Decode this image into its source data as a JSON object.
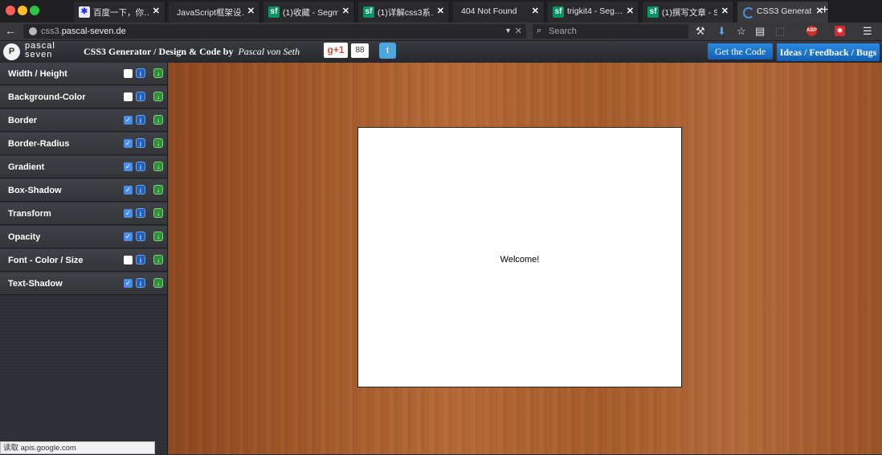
{
  "tabs": [
    {
      "title": "百度一下，你…",
      "favicon": "baidu-icon",
      "active": false
    },
    {
      "title": "JavaScript框架设…",
      "favicon": "",
      "active": false
    },
    {
      "title": "(1)收藏 - Segm…",
      "favicon": "sf-icon",
      "active": false
    },
    {
      "title": "(1)详解css3系…",
      "favicon": "sf-icon",
      "active": false
    },
    {
      "title": "404 Not Found",
      "favicon": "",
      "active": false
    },
    {
      "title": "trigkit4 - Seg…",
      "favicon": "sf-icon",
      "active": false
    },
    {
      "title": "(1)撰写文章 - S…",
      "favicon": "sf-icon",
      "active": false
    },
    {
      "title": "CSS3 Generat…",
      "favicon": "loading-icon",
      "active": true
    }
  ],
  "tab_close": "✕",
  "new_tab": "+",
  "favicon_sf_text": "sf",
  "favicon_baidu_text": "✱",
  "nav": {
    "back": "←",
    "url_prefix": "css3.",
    "url_host": "pascal-seven.de",
    "url_drop": "▼",
    "url_clear": "✕",
    "search_placeholder": "Search",
    "search_glyph": "⌕",
    "icons": {
      "wrench": "⚒",
      "download": "⬇",
      "star": "☆",
      "clipboard": "▤",
      "pocket": "⬚",
      "menu": "☰"
    },
    "abp_text": "ABP",
    "ext_text": "✱"
  },
  "header": {
    "logo_glyph": "P",
    "logo_top": "pascal",
    "logo_bottom": "seven",
    "title": "CSS3 Generator  /  Design & Code by",
    "author": "Pascal von Seth",
    "gplus_label": "g+1",
    "gplus_count": "88",
    "twitter_glyph": "t",
    "get_code": "Get the Code",
    "ideas": "Ideas / Feedback / Bugs"
  },
  "sidebar": {
    "items": [
      {
        "label": "Width / Height",
        "checked": false
      },
      {
        "label": "Background-Color",
        "checked": false
      },
      {
        "label": "Border",
        "checked": true
      },
      {
        "label": "Border-Radius",
        "checked": true
      },
      {
        "label": "Gradient",
        "checked": true
      },
      {
        "label": "Box-Shadow",
        "checked": true
      },
      {
        "label": "Transform",
        "checked": true
      },
      {
        "label": "Opacity",
        "checked": true
      },
      {
        "label": "Font - Color / Size",
        "checked": false
      },
      {
        "label": "Text-Shadow",
        "checked": true
      }
    ],
    "check_glyph": "✓",
    "info_glyph": "i",
    "down_glyph": "↓"
  },
  "preview": {
    "text": "Welcome!"
  },
  "status": "读取 apis.google.com"
}
